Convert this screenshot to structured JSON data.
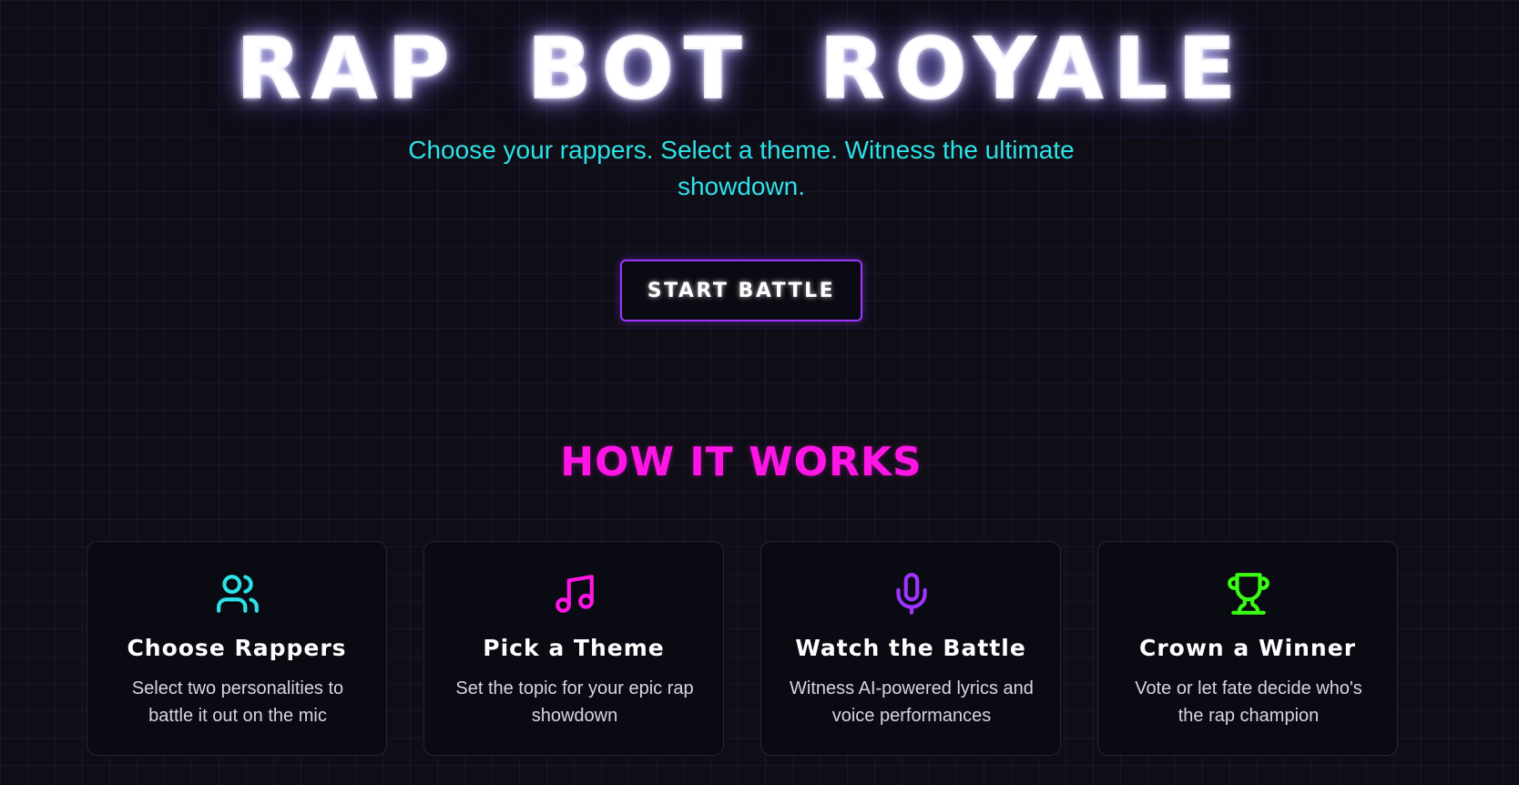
{
  "hero": {
    "title": "RAP BOT ROYALE",
    "tagline": "Choose your rappers. Select a theme. Witness the ultimate showdown.",
    "start_button_label": "START BATTLE"
  },
  "how_it_works": {
    "title": "HOW IT WORKS",
    "steps": [
      {
        "icon": "users-icon",
        "color": "#2de2e6",
        "title": "Choose Rappers",
        "description": "Select two personalities to battle it out on the mic"
      },
      {
        "icon": "music-note-icon",
        "color": "#ff16e6",
        "title": "Pick a Theme",
        "description": "Set the topic for your epic rap showdown"
      },
      {
        "icon": "microphone-icon",
        "color": "#9d35ff",
        "title": "Watch the Battle",
        "description": "Witness AI-powered lyrics and voice performances"
      },
      {
        "icon": "trophy-icon",
        "color": "#39ff14",
        "title": "Crown a Winner",
        "description": "Vote or let fate decide who's the rap champion"
      }
    ]
  },
  "colors": {
    "background": "#0f0e17",
    "cyan": "#2de2e6",
    "magenta": "#ff16e6",
    "purple": "#9d35ff",
    "green": "#39ff14"
  }
}
